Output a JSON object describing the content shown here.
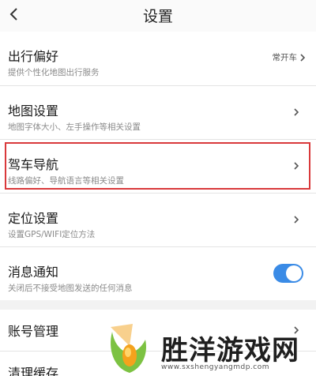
{
  "header": {
    "title": "设置",
    "back_icon": "chevron-left-icon"
  },
  "settings": [
    {
      "title": "出行偏好",
      "subtitle": "提供个性化地图出行服务",
      "value": "常开车",
      "control": "chevron"
    },
    {
      "title": "地图设置",
      "subtitle": "地图字体大小、左手操作等相关设置",
      "control": "chevron"
    },
    {
      "title": "驾车导航",
      "subtitle": "线路偏好、导航语言等相关设置",
      "control": "chevron",
      "highlighted": true
    },
    {
      "title": "定位设置",
      "subtitle": "设置GPS/WIFI定位方法",
      "control": "chevron"
    },
    {
      "title": "消息通知",
      "subtitle": "关闭后不接受地图发送的任何消息",
      "control": "toggle",
      "toggle_on": true
    }
  ],
  "account": {
    "title": "账号管理"
  },
  "cache": {
    "title": "清理缓存"
  },
  "watermark": {
    "text": "胜洋游戏网",
    "url": "www.sxshengyangmdp.com"
  },
  "colors": {
    "highlight_border": "#d9393b",
    "toggle_on": "#3a8be6",
    "logo_green": "#7cc242",
    "logo_orange": "#f4a21d"
  }
}
